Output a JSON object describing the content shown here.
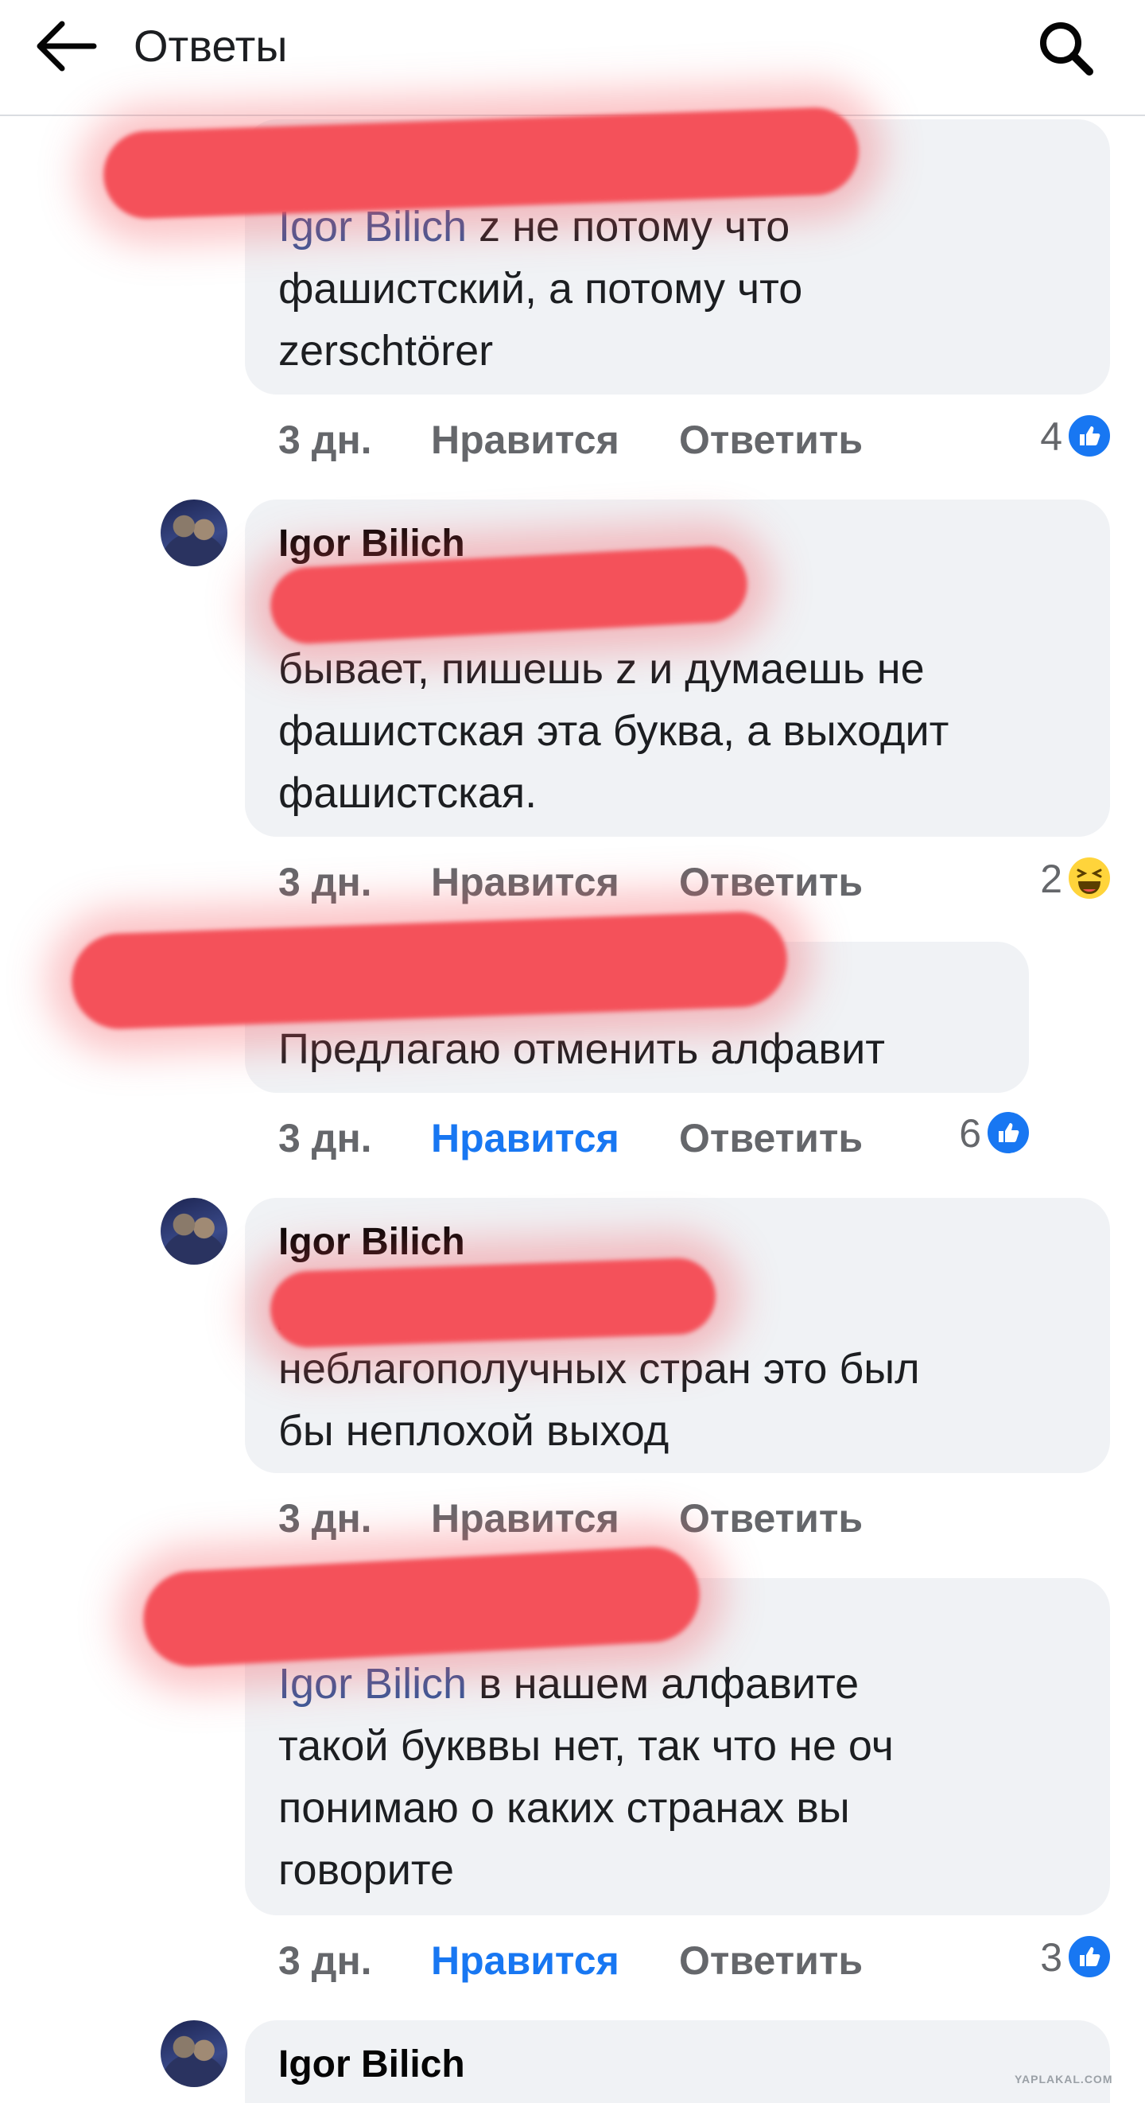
{
  "header": {
    "title": "Ответы"
  },
  "comments": [
    {
      "text_mention": "Igor Bilich",
      "text": " z не потому что\nфашистский, а потому что\nzerschtörer",
      "time": "3 дн.",
      "like_label": "Нравится",
      "reply_label": "Ответить",
      "reaction_count": "4",
      "reaction_type": "like-icon"
    },
    {
      "author": "Igor Bilich",
      "text": "так часто\nбывает, пишешь z и думаешь не\nфашистская эта буква, а выходит\nфашистская.",
      "time": "3 дн.",
      "like_label": "Нравится",
      "reply_label": "Ответить",
      "reaction_count": "2",
      "reaction_type": "haha-icon"
    },
    {
      "text": "Предлагаю отменить алфавит",
      "time": "3 дн.",
      "like_label": "Нравится",
      "reply_label": "Ответить",
      "reaction_count": "6",
      "reaction_type": "like-icon"
    },
    {
      "author": "Igor Bilich",
      "text": "для некоторых\nнеблагополучных стран это был\nбы неплохой выход",
      "time": "3 дн.",
      "like_label": "Нравится",
      "reply_label": "Ответить"
    },
    {
      "text_mention": "Igor Bilich",
      "text": " в нашем алфавите\nтакой букввы нет, так что не оч\nпонимаю о каких странах вы\nговорите",
      "time": "3 дн.",
      "like_label": "Нравится",
      "reply_label": "Ответить",
      "reaction_count": "3",
      "reaction_type": "like-icon"
    },
    {
      "author": "Igor Bilich"
    }
  ],
  "watermark": "YAPLAKAL.COM",
  "colors": {
    "link": "#385898",
    "liked": "#1877f2",
    "redaction": "#f4515a"
  }
}
